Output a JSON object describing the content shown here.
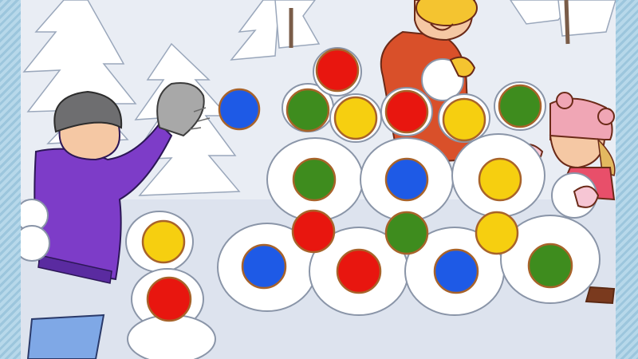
{
  "game": {
    "colors": {
      "red": "#e8160f",
      "blue": "#1e5ae6",
      "green": "#3e8c1e",
      "yellow": "#f6cf10"
    },
    "balls": [
      {
        "name": "ball-flying",
        "color": "blue"
      },
      {
        "name": "ball-top",
        "color": "red"
      },
      {
        "name": "ball-row1-1",
        "color": "green"
      },
      {
        "name": "ball-row1-2",
        "color": "yellow"
      },
      {
        "name": "ball-row1-3",
        "color": "red"
      },
      {
        "name": "ball-row1-4",
        "color": "yellow"
      },
      {
        "name": "ball-row1-5",
        "color": "green"
      },
      {
        "name": "ball-mid-1",
        "color": "green"
      },
      {
        "name": "ball-mid-2",
        "color": "blue"
      },
      {
        "name": "ball-mid-3",
        "color": "yellow"
      },
      {
        "name": "ball-row3-1",
        "color": "red"
      },
      {
        "name": "ball-row3-2",
        "color": "green"
      },
      {
        "name": "ball-row3-3",
        "color": "yellow"
      },
      {
        "name": "ball-bottom-1",
        "color": "blue"
      },
      {
        "name": "ball-bottom-2",
        "color": "red"
      },
      {
        "name": "ball-bottom-3",
        "color": "blue"
      },
      {
        "name": "ball-bottom-4",
        "color": "green"
      },
      {
        "name": "ball-left-top",
        "color": "yellow"
      },
      {
        "name": "ball-left-bottom",
        "color": "red"
      }
    ]
  }
}
